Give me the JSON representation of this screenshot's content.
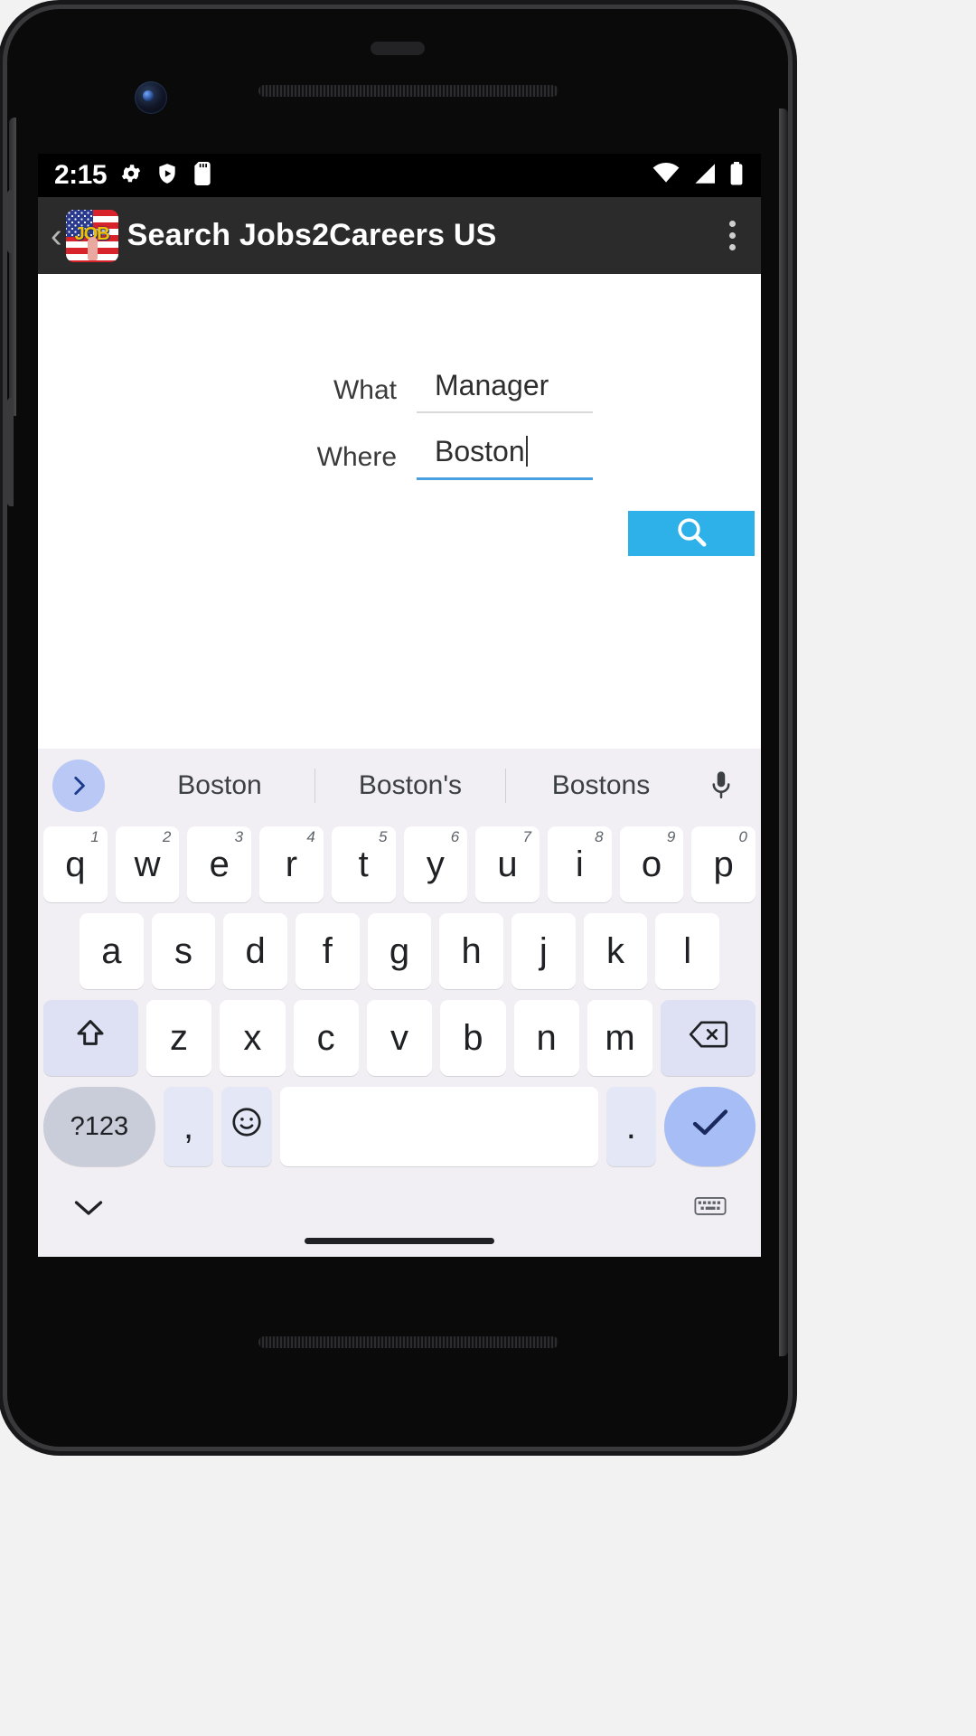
{
  "status_bar": {
    "time": "2:15",
    "left_icons": [
      "gear-icon",
      "shield-play-icon",
      "sd-card-icon"
    ],
    "right_icons": [
      "wifi-icon",
      "cellular-signal-icon",
      "battery-icon"
    ]
  },
  "app_bar": {
    "back_label": "‹",
    "app_icon_text": "JOB",
    "title": "Search Jobs2Careers US",
    "overflow_label": "more-options"
  },
  "form": {
    "what": {
      "label": "What",
      "value": "Manager",
      "placeholder": "What"
    },
    "where": {
      "label": "Where",
      "value": "Boston",
      "placeholder": "Where",
      "focused": true
    },
    "search_button": {
      "label": "search-icon",
      "color": "#2eb1e8"
    }
  },
  "keyboard": {
    "suggestions": [
      "Boston",
      "Boston's",
      "Bostons"
    ],
    "expand_icon": "chevron-right-icon",
    "mic_icon": "microphone-icon",
    "row1": [
      {
        "key": "q",
        "num": "1"
      },
      {
        "key": "w",
        "num": "2"
      },
      {
        "key": "e",
        "num": "3"
      },
      {
        "key": "r",
        "num": "4"
      },
      {
        "key": "t",
        "num": "5"
      },
      {
        "key": "y",
        "num": "6"
      },
      {
        "key": "u",
        "num": "7"
      },
      {
        "key": "i",
        "num": "8"
      },
      {
        "key": "o",
        "num": "9"
      },
      {
        "key": "p",
        "num": "0"
      }
    ],
    "row2": [
      "a",
      "s",
      "d",
      "f",
      "g",
      "h",
      "j",
      "k",
      "l"
    ],
    "row3": [
      "z",
      "x",
      "c",
      "v",
      "b",
      "n",
      "m"
    ],
    "shift_label": "shift-icon",
    "backspace_label": "backspace-icon",
    "symbols_label": "?123",
    "comma_label": ",",
    "emoji_label": "emoji-icon",
    "space_label": "",
    "period_label": ".",
    "enter_label": "checkmark-icon",
    "hide_keyboard_label": "chevron-down-icon",
    "switch_keyboard_label": "keyboard-switch-icon"
  },
  "colors": {
    "accent": "#2eb1e8",
    "app_bar_bg": "#2b2b2b",
    "keyboard_bg": "#f1eff4",
    "key_bg": "#ffffff",
    "mod_key_bg": "#dde1f3",
    "enter_key_bg": "#a6bdf5",
    "focus_underline": "#4a9fe0"
  }
}
